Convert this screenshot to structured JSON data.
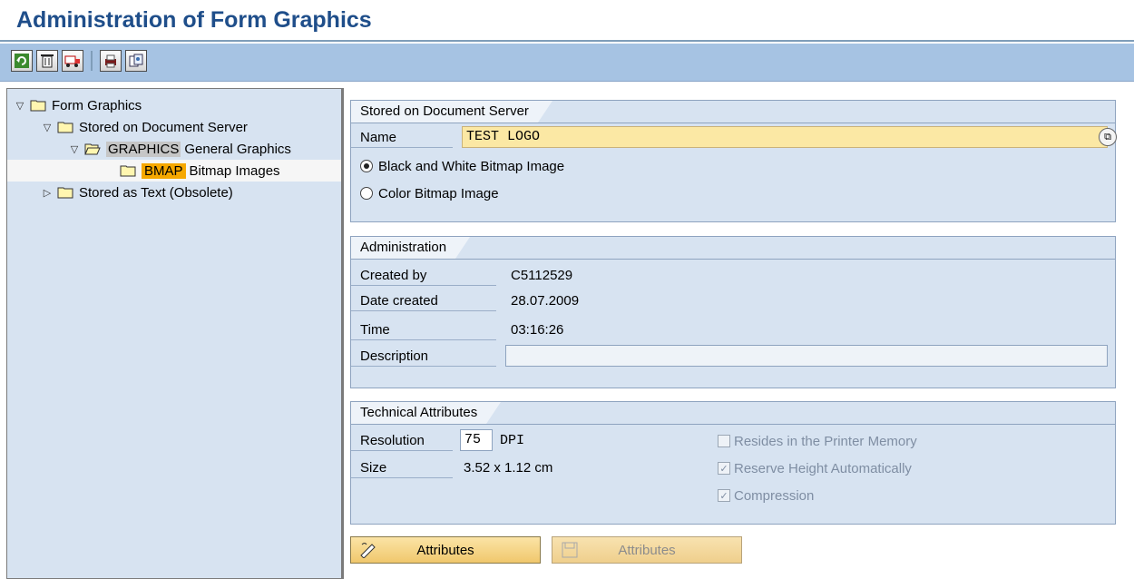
{
  "window": {
    "title": "Administration of Form Graphics"
  },
  "toolbar": {
    "buttons": [
      {
        "icon": "refresh-icon"
      },
      {
        "icon": "delete-icon"
      },
      {
        "icon": "transport-icon"
      },
      {
        "icon": "print-icon"
      },
      {
        "icon": "copy-icon"
      }
    ]
  },
  "tree": {
    "root": "Form Graphics",
    "server_node": "Stored on Document Server",
    "graphics_key": "GRAPHICS",
    "graphics_label": "General Graphics",
    "bmap_key": "BMAP",
    "bmap_label": "Bitmap Images",
    "text_node": "Stored as Text (Obsolete)"
  },
  "server_panel": {
    "title": "Stored on Document Server",
    "name_label": "Name",
    "name_value": "TEST LOGO",
    "radio_bw": "Black and White Bitmap Image",
    "radio_color": "Color Bitmap Image",
    "selected": "bw"
  },
  "admin_panel": {
    "title": "Administration",
    "created_by_label": "Created by",
    "created_by": "C5112529",
    "date_label": "Date created",
    "date": "28.07.2009",
    "time_label": "Time",
    "time": "03:16:26",
    "description_label": "Description",
    "description": ""
  },
  "tech_panel": {
    "title": "Technical Attributes",
    "resolution_label": "Resolution",
    "resolution": "75",
    "resolution_unit": "DPI",
    "size_label": "Size",
    "size": "3.52 x 1.12 cm",
    "printer_memory": "Resides in the Printer Memory",
    "reserve_height": "Reserve Height Automatically",
    "compression": "Compression"
  },
  "buttons": {
    "attributes_edit": "Attributes",
    "attributes_save": "Attributes"
  },
  "colors": {
    "title": "#1f4e8a",
    "toolbar": "#a6c3e3",
    "panel": "#d7e3f1",
    "name_field": "#fbe8a4",
    "button": "#f0c76c"
  }
}
